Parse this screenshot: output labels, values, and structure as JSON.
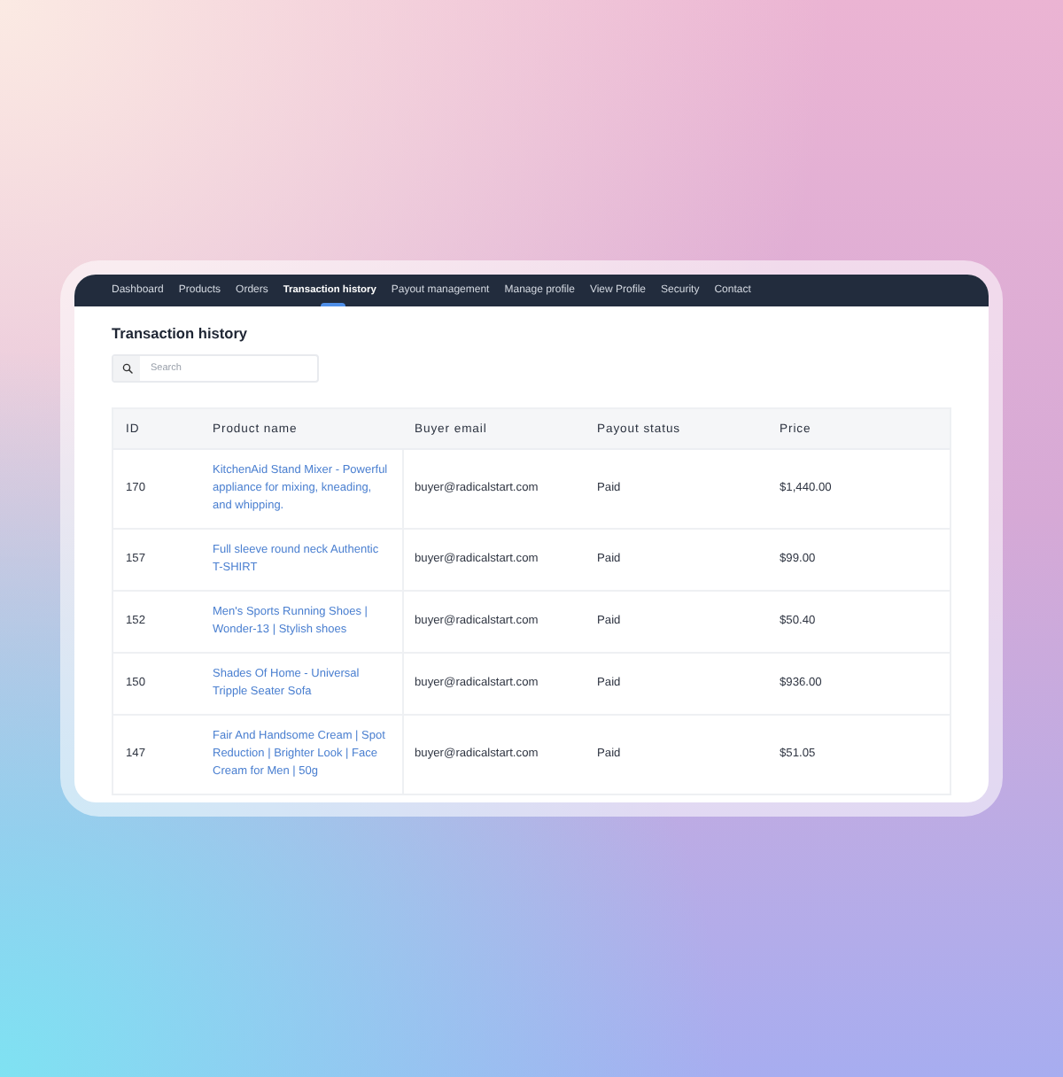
{
  "nav": {
    "items": [
      {
        "label": "Dashboard",
        "selected": false
      },
      {
        "label": "Products",
        "selected": false
      },
      {
        "label": "Orders",
        "selected": false
      },
      {
        "label": "Transaction history",
        "selected": true
      },
      {
        "label": "Payout management",
        "selected": false
      },
      {
        "label": "Manage profile",
        "selected": false
      },
      {
        "label": "View Profile",
        "selected": false
      },
      {
        "label": "Security",
        "selected": false
      },
      {
        "label": "Contact",
        "selected": false
      }
    ]
  },
  "page": {
    "title": "Transaction history",
    "search": {
      "placeholder": "Search"
    }
  },
  "table": {
    "columns": [
      "ID",
      "Product name",
      "Buyer email",
      "Payout status",
      "Price"
    ],
    "rows": [
      {
        "id": "170",
        "product": "KitchenAid Stand Mixer - Powerful appliance for mixing, kneading, and whipping.",
        "email": "buyer@radicalstart.com",
        "status": "Paid",
        "price": "$1,440.00"
      },
      {
        "id": "157",
        "product": "Full sleeve round neck Authentic T-SHIRT",
        "email": "buyer@radicalstart.com",
        "status": "Paid",
        "price": "$99.00"
      },
      {
        "id": "152",
        "product": "Men's Sports Running Shoes | Wonder-13 | Stylish shoes",
        "email": "buyer@radicalstart.com",
        "status": "Paid",
        "price": "$50.40"
      },
      {
        "id": "150",
        "product": "Shades Of Home - Universal Tripple Seater Sofa",
        "email": "buyer@radicalstart.com",
        "status": "Paid",
        "price": "$936.00"
      },
      {
        "id": "147",
        "product": "Fair And Handsome Cream | Spot Reduction | Brighter Look | Face Cream for Men | 50g",
        "email": "buyer@radicalstart.com",
        "status": "Paid",
        "price": "$51.05"
      }
    ]
  }
}
